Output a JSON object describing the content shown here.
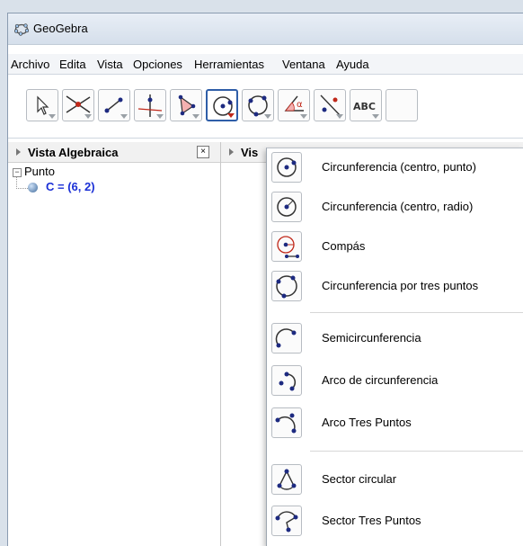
{
  "window": {
    "title": "GeoGebra"
  },
  "menu": [
    "Archivo",
    "Edita",
    "Vista",
    "Opciones",
    "Herramientas",
    "Ventana",
    "Ayuda"
  ],
  "toolbar": {
    "tools": [
      {
        "name": "move-tool-icon"
      },
      {
        "name": "intersect-tool-icon"
      },
      {
        "name": "segment-tool-icon"
      },
      {
        "name": "perpendicular-tool-icon"
      },
      {
        "name": "polygon-tool-icon"
      },
      {
        "name": "circle-tool-icon",
        "active": true
      },
      {
        "name": "circle-three-points-tool-icon"
      },
      {
        "name": "angle-tool-icon",
        "glyph": "α"
      },
      {
        "name": "reflect-tool-icon"
      },
      {
        "name": "text-tool-icon",
        "glyph": "ABC"
      }
    ]
  },
  "algebra_view": {
    "title": "Vista Algebraica",
    "close_glyph": "×",
    "group": "Punto",
    "object": "C = (6, 2)"
  },
  "graphics_view": {
    "title": "Vis"
  },
  "dropdown": {
    "items": [
      {
        "label": "Circunferencia (centro, punto)",
        "icon": "circle-center-point-icon"
      },
      {
        "label": "Circunferencia (centro, radio)",
        "icon": "circle-center-radius-icon"
      },
      {
        "label": "Compás",
        "icon": "compass-icon"
      },
      {
        "label": "Circunferencia por tres puntos",
        "icon": "circle-three-points-icon"
      },
      {
        "label": "Semicircunferencia",
        "icon": "semicircle-icon"
      },
      {
        "label": "Arco de circunferencia",
        "icon": "circular-arc-icon"
      },
      {
        "label": "Arco Tres Puntos",
        "icon": "arc-three-points-icon"
      },
      {
        "label": "Sector circular",
        "icon": "circular-sector-icon"
      },
      {
        "label": "Sector Tres Puntos",
        "icon": "sector-three-points-icon"
      }
    ]
  },
  "colors": {
    "accent": "#2f5ea8",
    "point_blue": "#1a2fd6",
    "point_dark": "#1d2a80",
    "red": "#c0281a"
  }
}
